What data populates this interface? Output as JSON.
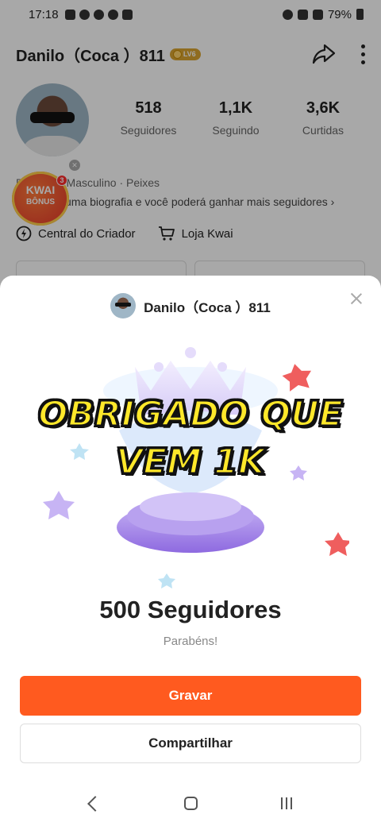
{
  "status_bar": {
    "time": "17:18",
    "battery": "79%"
  },
  "profile": {
    "name": "Danilo（Coca ）811",
    "level_badge": "LV6",
    "stats": [
      {
        "value": "518",
        "label": "Seguidores"
      },
      {
        "value": "1,1K",
        "label": "Seguindo"
      },
      {
        "value": "3,6K",
        "label": "Curtidas"
      }
    ],
    "meta": "D     ca811 · Masculino · Peixes",
    "bio": "uma biografia e você poderá ganhar mais seguidores",
    "bonus": {
      "line1": "KWAI",
      "line2": "BÔNUS",
      "count": "3"
    },
    "links": {
      "creator_center": "Central do Criador",
      "store": "Loja Kwai"
    }
  },
  "sheet": {
    "name": "Danilo（Coca ）811",
    "overlay_caption": [
      "OBRIGADO QUE",
      "VEM 1K"
    ],
    "milestone": "500 Seguidores",
    "congrats": "Parabéns!",
    "primary_button": "Gravar",
    "secondary_button": "Compartilhar"
  },
  "colors": {
    "accent": "#ff5a1f",
    "caption_fill": "#ffe82a",
    "caption_stroke": "#111111"
  },
  "icons": [
    "share-arrow-icon",
    "more-vert-icon",
    "lightning-icon",
    "cart-icon",
    "close-icon",
    "back-icon",
    "home-icon",
    "recents-icon"
  ]
}
